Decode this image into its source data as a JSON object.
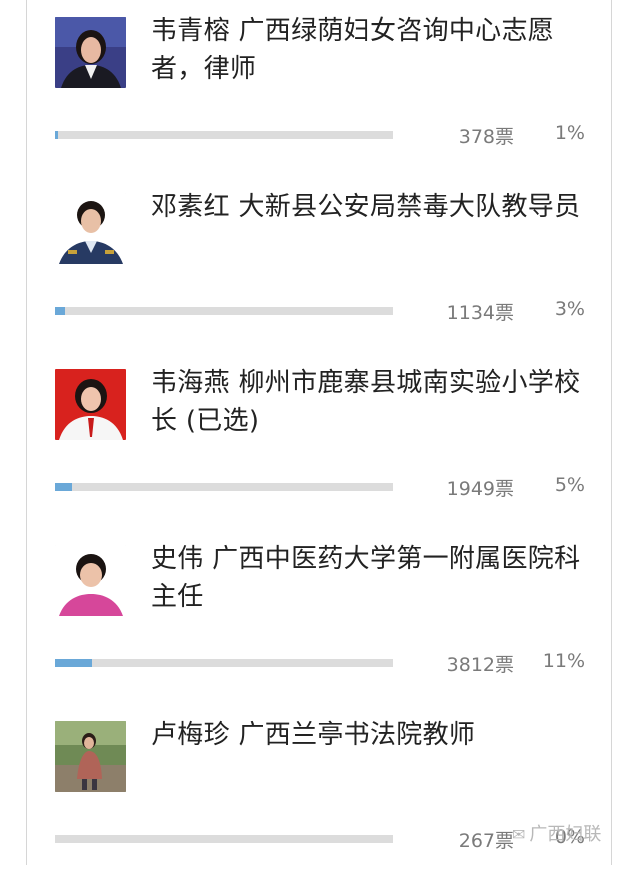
{
  "candidates": [
    {
      "name": "韦青榕 广西绿荫妇女咨询中心志愿者，律师",
      "votes": "378票",
      "percent": "1%",
      "progress": 0.01
    },
    {
      "name": "邓素红 大新县公安局禁毒大队教导员",
      "votes": "1134票",
      "percent": "3%",
      "progress": 0.03
    },
    {
      "name": "韦海燕 柳州市鹿寨县城南实验小学校长 (已选)",
      "votes": "1949票",
      "percent": "5%",
      "progress": 0.05
    },
    {
      "name": "史伟 广西中医药大学第一附属医院科主任",
      "votes": "3812票",
      "percent": "11%",
      "progress": 0.11
    },
    {
      "name": "卢梅珍 广西兰亭书法院教师",
      "votes": "267票",
      "percent": "0%",
      "progress": 0.0
    }
  ],
  "watermark": {
    "text": "广西妇联",
    "icon": "wechat-icon"
  },
  "colors": {
    "bar_fill": "#6aa8d8",
    "bar_track": "#dcdcdc"
  }
}
